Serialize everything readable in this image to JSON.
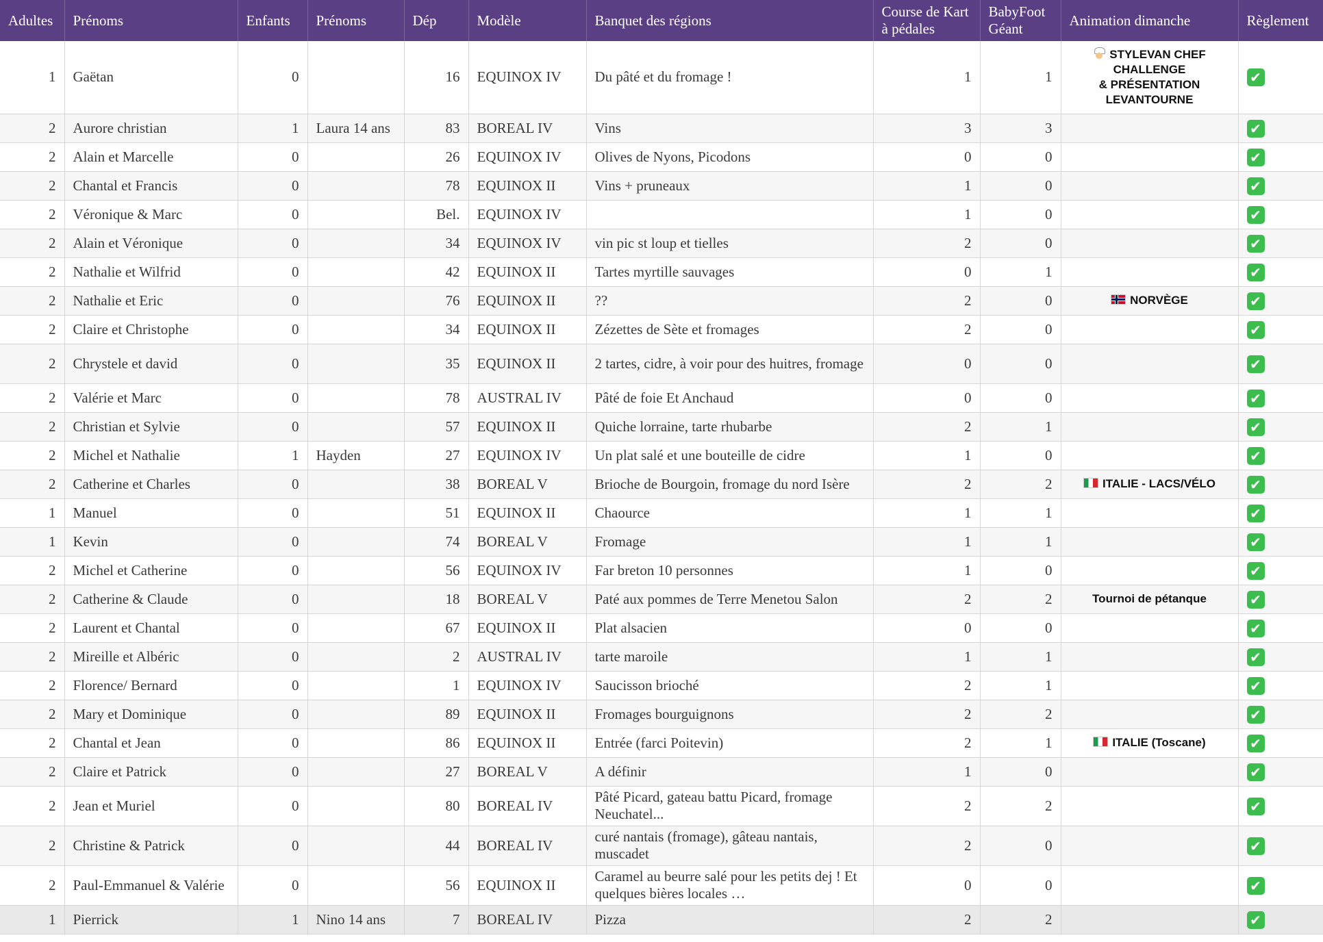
{
  "headers": {
    "adultes": "Adultes",
    "prenoms": "Prénoms",
    "enfants": "Enfants",
    "prenoms_enfants": "Prénoms",
    "dep": "Dép",
    "modele": "Modèle",
    "banquet": "Banquet des régions",
    "kart": "Course de Kart\nà pédales",
    "babyfoot": "BabyFoot\nGéant",
    "animation": "Animation dimanche",
    "reglement": "Règlement"
  },
  "icons": {
    "check": "check-mark-button-icon",
    "chef": "chef-icon",
    "flag_norway": "norway-flag-icon",
    "flag_italy": "italy-flag-icon"
  },
  "colors": {
    "header_bg": "#5a3f84",
    "check_green": "#3dbd4e"
  },
  "rows": [
    {
      "adultes": "1",
      "prenoms": "Gaëtan",
      "enfants": "0",
      "prenoms_enfants": "",
      "dep": "16",
      "modele": "EQUINOX IV",
      "banquet": "Du pâté et du fromage !",
      "kart": "1",
      "babyfoot": "1",
      "animation": "STYLEVAN CHEF\nCHALLENGE\n& PRÉSENTATION\nLEVANTOURNE",
      "animation_icon": "chef-icon",
      "reglement": "✔"
    },
    {
      "adultes": "2",
      "prenoms": "Aurore christian",
      "enfants": "1",
      "prenoms_enfants": "Laura 14 ans",
      "dep": "83",
      "modele": "BOREAL IV",
      "banquet": "Vins",
      "kart": "3",
      "babyfoot": "3",
      "animation": "",
      "animation_icon": "",
      "reglement": "✔"
    },
    {
      "adultes": "2",
      "prenoms": "Alain et Marcelle",
      "enfants": "0",
      "prenoms_enfants": "",
      "dep": "26",
      "modele": "EQUINOX IV",
      "banquet": "Olives de Nyons, Picodons",
      "kart": "0",
      "babyfoot": "0",
      "animation": "",
      "animation_icon": "",
      "reglement": "✔"
    },
    {
      "adultes": "2",
      "prenoms": "Chantal et Francis",
      "enfants": "0",
      "prenoms_enfants": "",
      "dep": "78",
      "modele": "EQUINOX II",
      "banquet": "Vins + pruneaux",
      "kart": "1",
      "babyfoot": "0",
      "animation": "",
      "animation_icon": "",
      "reglement": "✔"
    },
    {
      "adultes": "2",
      "prenoms": "Véronique & Marc",
      "enfants": "0",
      "prenoms_enfants": "",
      "dep": "Bel.",
      "modele": "EQUINOX IV",
      "banquet": "",
      "kart": "1",
      "babyfoot": "0",
      "animation": "",
      "animation_icon": "",
      "reglement": "✔"
    },
    {
      "adultes": "2",
      "prenoms": "Alain et Véronique",
      "enfants": "0",
      "prenoms_enfants": "",
      "dep": "34",
      "modele": "EQUINOX IV",
      "banquet": "vin pic st loup et tielles",
      "kart": "2",
      "babyfoot": "0",
      "animation": "",
      "animation_icon": "",
      "reglement": "✔"
    },
    {
      "adultes": "2",
      "prenoms": "Nathalie et Wilfrid",
      "enfants": "0",
      "prenoms_enfants": "",
      "dep": "42",
      "modele": "EQUINOX II",
      "banquet": "Tartes myrtille sauvages",
      "kart": "0",
      "babyfoot": "1",
      "animation": "",
      "animation_icon": "",
      "reglement": "✔"
    },
    {
      "adultes": "2",
      "prenoms": "Nathalie et Eric",
      "enfants": "0",
      "prenoms_enfants": "",
      "dep": "76",
      "modele": "EQUINOX II",
      "banquet": "??",
      "kart": "2",
      "babyfoot": "0",
      "animation": "NORVÈGE",
      "animation_icon": "norway-flag-icon",
      "reglement": "✔"
    },
    {
      "adultes": "2",
      "prenoms": "Claire et Christophe",
      "enfants": "0",
      "prenoms_enfants": "",
      "dep": "34",
      "modele": "EQUINOX II",
      "banquet": "Zézettes de Sète et fromages",
      "kart": "2",
      "babyfoot": "0",
      "animation": "",
      "animation_icon": "",
      "reglement": "✔"
    },
    {
      "adultes": "2",
      "prenoms": "Chrystele et david",
      "enfants": "0",
      "prenoms_enfants": "",
      "dep": "35",
      "modele": "EQUINOX II",
      "banquet": "2 tartes, cidre, à voir pour des huitres, fromage",
      "kart": "0",
      "babyfoot": "0",
      "animation": "",
      "animation_icon": "",
      "reglement": "✔"
    },
    {
      "adultes": "2",
      "prenoms": "Valérie et Marc",
      "enfants": "0",
      "prenoms_enfants": "",
      "dep": "78",
      "modele": "AUSTRAL IV",
      "banquet": "Pâté de foie Et Anchaud",
      "kart": "0",
      "babyfoot": "0",
      "animation": "",
      "animation_icon": "",
      "reglement": "✔"
    },
    {
      "adultes": "2",
      "prenoms": "Christian et Sylvie",
      "enfants": "0",
      "prenoms_enfants": "",
      "dep": "57",
      "modele": "EQUINOX II",
      "banquet": "Quiche lorraine, tarte rhubarbe",
      "kart": "2",
      "babyfoot": "1",
      "animation": "",
      "animation_icon": "",
      "reglement": "✔"
    },
    {
      "adultes": "2",
      "prenoms": "Michel et Nathalie",
      "enfants": "1",
      "prenoms_enfants": "Hayden",
      "dep": "27",
      "modele": "EQUINOX IV",
      "banquet": "Un plat salé et une bouteille de cidre",
      "kart": "1",
      "babyfoot": "0",
      "animation": "",
      "animation_icon": "",
      "reglement": "✔"
    },
    {
      "adultes": "2",
      "prenoms": "Catherine et Charles",
      "enfants": "0",
      "prenoms_enfants": "",
      "dep": "38",
      "modele": "BOREAL V",
      "banquet": "Brioche de Bourgoin, fromage du nord Isère",
      "kart": "2",
      "babyfoot": "2",
      "animation": "ITALIE - LACS/VÉLO",
      "animation_icon": "italy-flag-icon",
      "reglement": "✔"
    },
    {
      "adultes": "1",
      "prenoms": "Manuel",
      "enfants": "0",
      "prenoms_enfants": "",
      "dep": "51",
      "modele": "EQUINOX II",
      "banquet": "Chaource",
      "kart": "1",
      "babyfoot": "1",
      "animation": "",
      "animation_icon": "",
      "reglement": "✔"
    },
    {
      "adultes": "1",
      "prenoms": "Kevin",
      "enfants": "0",
      "prenoms_enfants": "",
      "dep": "74",
      "modele": "BOREAL V",
      "banquet": "Fromage",
      "kart": "1",
      "babyfoot": "1",
      "animation": "",
      "animation_icon": "",
      "reglement": "✔"
    },
    {
      "adultes": "2",
      "prenoms": "Michel et Catherine",
      "enfants": "0",
      "prenoms_enfants": "",
      "dep": "56",
      "modele": "EQUINOX IV",
      "banquet": "Far breton 10 personnes",
      "kart": "1",
      "babyfoot": "0",
      "animation": "",
      "animation_icon": "",
      "reglement": "✔"
    },
    {
      "adultes": "2",
      "prenoms": "Catherine & Claude",
      "enfants": "0",
      "prenoms_enfants": "",
      "dep": "18",
      "modele": "BOREAL V",
      "banquet": "Paté aux pommes de Terre Menetou Salon",
      "kart": "2",
      "babyfoot": "2",
      "animation": "Tournoi de pétanque",
      "animation_icon": "",
      "reglement": "✔"
    },
    {
      "adultes": "2",
      "prenoms": "Laurent et Chantal",
      "enfants": "0",
      "prenoms_enfants": "",
      "dep": "67",
      "modele": "EQUINOX II",
      "banquet": "Plat alsacien",
      "kart": "0",
      "babyfoot": "0",
      "animation": "",
      "animation_icon": "",
      "reglement": "✔"
    },
    {
      "adultes": "2",
      "prenoms": "Mireille et Albéric",
      "enfants": "0",
      "prenoms_enfants": "",
      "dep": "2",
      "modele": "AUSTRAL IV",
      "banquet": "tarte maroile",
      "kart": "1",
      "babyfoot": "1",
      "animation": "",
      "animation_icon": "",
      "reglement": "✔"
    },
    {
      "adultes": "2",
      "prenoms": "Florence/ Bernard",
      "enfants": "0",
      "prenoms_enfants": "",
      "dep": "1",
      "modele": "EQUINOX IV",
      "banquet": "Saucisson brioché",
      "kart": "2",
      "babyfoot": "1",
      "animation": "",
      "animation_icon": "",
      "reglement": "✔"
    },
    {
      "adultes": "2",
      "prenoms": "Mary et Dominique",
      "enfants": "0",
      "prenoms_enfants": "",
      "dep": "89",
      "modele": "EQUINOX II",
      "banquet": "Fromages bourguignons",
      "kart": "2",
      "babyfoot": "2",
      "animation": "",
      "animation_icon": "",
      "reglement": "✔"
    },
    {
      "adultes": "2",
      "prenoms": "Chantal et Jean",
      "enfants": "0",
      "prenoms_enfants": "",
      "dep": "86",
      "modele": "EQUINOX II",
      "banquet": "Entrée (farci Poitevin)",
      "kart": "2",
      "babyfoot": "1",
      "animation": "ITALIE (Toscane)",
      "animation_icon": "italy-flag-icon",
      "reglement": "✔"
    },
    {
      "adultes": "2",
      "prenoms": "Claire et Patrick",
      "enfants": "0",
      "prenoms_enfants": "",
      "dep": "27",
      "modele": "BOREAL V",
      "banquet": "A définir",
      "kart": "1",
      "babyfoot": "0",
      "animation": "",
      "animation_icon": "",
      "reglement": "✔"
    },
    {
      "adultes": "2",
      "prenoms": "Jean et Muriel",
      "enfants": "0",
      "prenoms_enfants": "",
      "dep": "80",
      "modele": "BOREAL IV",
      "banquet": "Pâté Picard, gateau battu Picard, fromage Neuchatel...",
      "kart": "2",
      "babyfoot": "2",
      "animation": "",
      "animation_icon": "",
      "reglement": "✔"
    },
    {
      "adultes": "2",
      "prenoms": "Christine & Patrick",
      "enfants": "0",
      "prenoms_enfants": "",
      "dep": "44",
      "modele": "BOREAL IV",
      "banquet": "curé nantais (fromage), gâteau nantais, muscadet",
      "kart": "2",
      "babyfoot": "0",
      "animation": "",
      "animation_icon": "",
      "reglement": "✔"
    },
    {
      "adultes": "2",
      "prenoms": "Paul-Emmanuel & Valérie",
      "enfants": "0",
      "prenoms_enfants": "",
      "dep": "56",
      "modele": "EQUINOX II",
      "banquet": "Caramel au beurre salé pour les petits dej ! Et quelques bières locales …",
      "kart": "0",
      "babyfoot": "0",
      "animation": "",
      "animation_icon": "",
      "reglement": "✔"
    },
    {
      "adultes": "1",
      "prenoms": "Pierrick",
      "enfants": "1",
      "prenoms_enfants": "Nino 14 ans",
      "dep": "7",
      "modele": "BOREAL IV",
      "banquet": "Pizza",
      "kart": "2",
      "babyfoot": "2",
      "animation": "",
      "animation_icon": "",
      "reglement": "✔"
    }
  ]
}
